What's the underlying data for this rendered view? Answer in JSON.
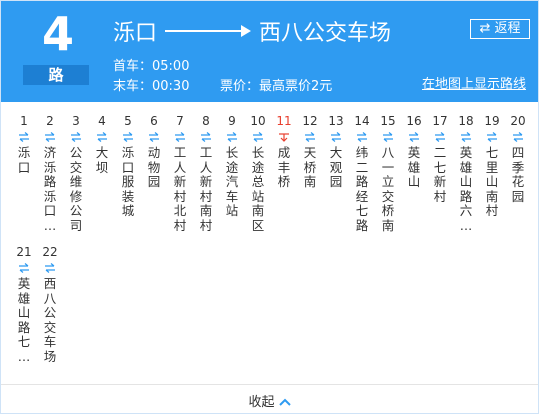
{
  "route": {
    "number": "4",
    "suffix": "路",
    "from": "泺口",
    "to": "西八公交车场",
    "return_label": "返程",
    "first_bus": "首车：05:00",
    "last_bus": "末车：00:30",
    "fare": "票价：最高票价2元",
    "map_link": "在地图上显示路线"
  },
  "stops": [
    {
      "n": "1",
      "name": "泺口"
    },
    {
      "n": "2",
      "name": "济泺路泺口…"
    },
    {
      "n": "3",
      "name": "公交维修公司"
    },
    {
      "n": "4",
      "name": "大坝"
    },
    {
      "n": "5",
      "name": "泺口服装城"
    },
    {
      "n": "6",
      "name": "动物园"
    },
    {
      "n": "7",
      "name": "工人新村北村"
    },
    {
      "n": "8",
      "name": "工人新村南村"
    },
    {
      "n": "9",
      "name": "长途汽车站"
    },
    {
      "n": "10",
      "name": "长途总站南区"
    },
    {
      "n": "11",
      "name": "成丰桥",
      "active": true
    },
    {
      "n": "12",
      "name": "天桥南"
    },
    {
      "n": "13",
      "name": "大观园"
    },
    {
      "n": "14",
      "name": "纬二路经七路"
    },
    {
      "n": "15",
      "name": "八一立交桥南"
    },
    {
      "n": "16",
      "name": "英雄山"
    },
    {
      "n": "17",
      "name": "二七新村"
    },
    {
      "n": "18",
      "name": "英雄山路六…"
    },
    {
      "n": "19",
      "name": "七里山南村"
    },
    {
      "n": "20",
      "name": "四季花园"
    },
    {
      "n": "21",
      "name": "英雄山路七…"
    },
    {
      "n": "22",
      "name": "西八公交车场"
    }
  ],
  "footer": {
    "collapse_label": "收起"
  },
  "colors": {
    "header": "#2f9bf1",
    "route_tag": "#1d7fd3",
    "active": "#e83f2f",
    "arrow": "#2f9bf1"
  },
  "icons": {
    "swap": "swap-icon",
    "direction": "two-way-arrow-icon",
    "bus": "bus-position-icon",
    "collapse": "chevron-up-icon"
  }
}
